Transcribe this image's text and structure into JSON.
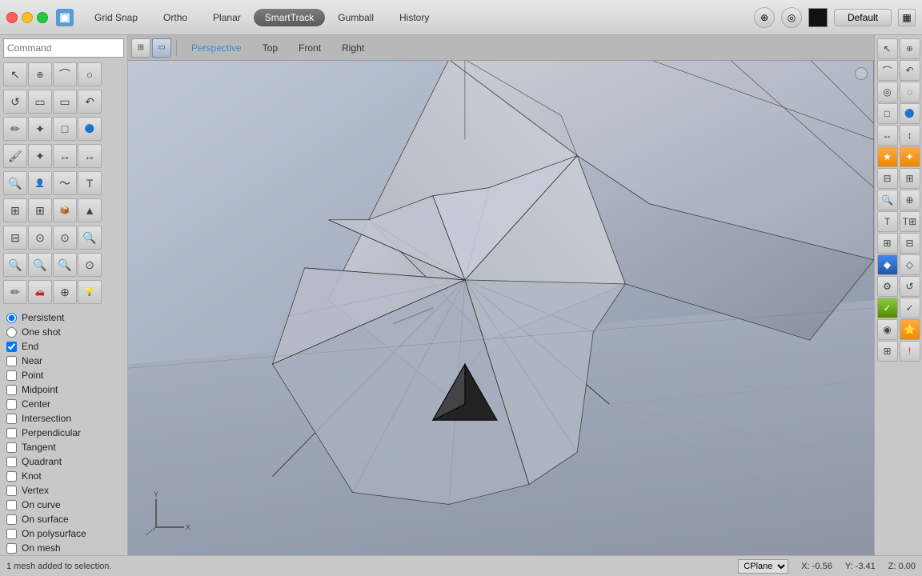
{
  "titlebar": {
    "nav": [
      {
        "label": "Grid Snap",
        "active": false
      },
      {
        "label": "Ortho",
        "active": false
      },
      {
        "label": "Planar",
        "active": false
      },
      {
        "label": "SmartTrack",
        "active": true
      },
      {
        "label": "Gumball",
        "active": false
      },
      {
        "label": "History",
        "active": false
      }
    ],
    "default_btn": "Default"
  },
  "left": {
    "command_placeholder": "Command",
    "tools_row1": [
      "↖",
      "⊕",
      "⌒",
      "○"
    ],
    "tools_row2": [
      "↺",
      "▭",
      "▭",
      "↶"
    ],
    "tools_row3": [
      "✏",
      "✦",
      "□",
      "🔵"
    ],
    "tools_row4": [
      "🖌",
      "✦",
      "↔",
      "↔"
    ],
    "tools_row5": [
      "🔍",
      "👤",
      "〜",
      "T"
    ],
    "tools_row6": [
      "⊞",
      "⊞",
      "📦",
      "▲"
    ],
    "tools_row7": [
      "⊟",
      "⊙",
      "⊙",
      "🔍"
    ],
    "tools_row8": [
      "🔍",
      "🔍",
      "🔍",
      "⊙"
    ],
    "tools_row9": [
      "✏",
      "🚗",
      "⊕",
      "💡"
    ]
  },
  "snap_options": {
    "persistent": {
      "label": "Persistent",
      "type": "radio",
      "checked": true
    },
    "one_shot": {
      "label": "One shot",
      "type": "radio",
      "checked": false
    },
    "items": [
      {
        "label": "End",
        "type": "checkbox",
        "checked": true
      },
      {
        "label": "Near",
        "type": "checkbox",
        "checked": false
      },
      {
        "label": "Point",
        "type": "checkbox",
        "checked": false
      },
      {
        "label": "Midpoint",
        "type": "checkbox",
        "checked": false
      },
      {
        "label": "Center",
        "type": "checkbox",
        "checked": false
      },
      {
        "label": "Intersection",
        "type": "checkbox",
        "checked": false
      },
      {
        "label": "Perpendicular",
        "type": "checkbox",
        "checked": false
      },
      {
        "label": "Tangent",
        "type": "checkbox",
        "checked": false
      },
      {
        "label": "Quadrant",
        "type": "checkbox",
        "checked": false
      },
      {
        "label": "Knot",
        "type": "checkbox",
        "checked": false
      },
      {
        "label": "Vertex",
        "type": "checkbox",
        "checked": false
      },
      {
        "label": "On curve",
        "type": "checkbox",
        "checked": false
      },
      {
        "label": "On surface",
        "type": "checkbox",
        "checked": false
      },
      {
        "label": "On polysurface",
        "type": "checkbox",
        "checked": false
      },
      {
        "label": "On mesh",
        "type": "checkbox",
        "checked": false
      }
    ]
  },
  "viewport": {
    "label": "Perspective",
    "tabs": [
      "Perspective",
      "Top",
      "Front",
      "Right"
    ]
  },
  "statusbar": {
    "message": "1 mesh added to selection.",
    "cplane": "CPlane",
    "x": "X: -0.56",
    "y": "Y: -3.41",
    "z": "Z: 0.00"
  }
}
